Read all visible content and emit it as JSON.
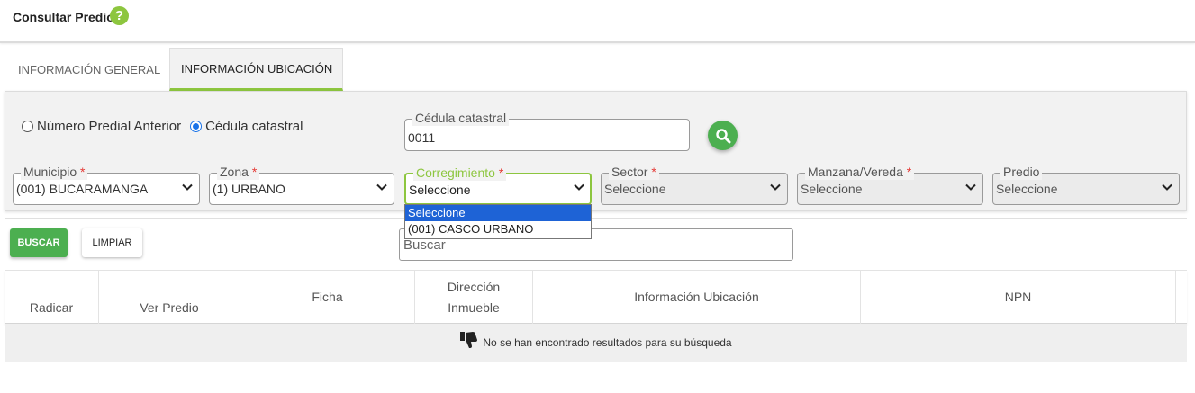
{
  "header": {
    "title": "Consultar Predio",
    "help_icon": "question-circle-icon",
    "help_glyph": "?"
  },
  "tabs": [
    {
      "label": "INFORMACIÓN GENERAL",
      "active": false
    },
    {
      "label": "INFORMACIÓN UBICACIÓN",
      "active": true
    }
  ],
  "search_mode": {
    "options": [
      {
        "label": "Número Predial Anterior",
        "checked": false
      },
      {
        "label": "Cédula catastral",
        "checked": true
      }
    ]
  },
  "cedula": {
    "label": "Cédula catastral",
    "value": "0011"
  },
  "filters": [
    {
      "label": "Municipio",
      "required": "*",
      "value": "(001) BUCARAMANGA"
    },
    {
      "label": "Zona",
      "required": "*",
      "value": "(1) URBANO"
    },
    {
      "label": "Corregimiento",
      "required": "*",
      "value": "Seleccione"
    },
    {
      "label": "Sector",
      "required": "*",
      "value": "Seleccione"
    },
    {
      "label": "Manzana/Vereda",
      "required": "*",
      "value": "Seleccione"
    },
    {
      "label": "Predio",
      "required": "",
      "value": "Seleccione"
    }
  ],
  "corregimiento_dropdown": {
    "options": [
      "Seleccione",
      "(001) CASCO URBANO"
    ],
    "selected_index": 0
  },
  "actions": {
    "buscar_label": "BUSCAR",
    "limpiar_label": "LIMPIAR"
  },
  "table_search": {
    "placeholder": "Buscar"
  },
  "table": {
    "columns": [
      "Radicar",
      "Ver Predio",
      "Ficha",
      "Dirección Inmueble",
      "Información Ubicación",
      "NPN"
    ],
    "empty_message": "No se han encontrado resultados para su búsqueda",
    "empty_icon": "thumbs-down-icon"
  },
  "colors": {
    "accent": "#8dc63f",
    "primary_button": "#4caf50",
    "required": "#e53935",
    "selection": "#1e63d6"
  }
}
